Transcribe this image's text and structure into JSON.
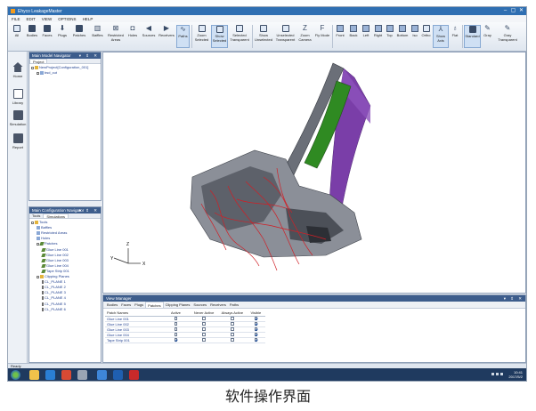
{
  "window": {
    "title": "Ehyco LeakageMaster",
    "controls": [
      "–",
      "▢",
      "✕"
    ]
  },
  "menu": [
    "FILE",
    "EDIT",
    "VIEW",
    "OPTIONS",
    "HELP"
  ],
  "ribbon": {
    "buttons": [
      {
        "label": "All"
      },
      {
        "label": "Bodies"
      },
      {
        "label": "Faces"
      },
      {
        "label": "Plugs"
      },
      {
        "label": "Patches"
      },
      {
        "label": "Baffles"
      },
      {
        "label": "Restricted\nAreas"
      },
      {
        "label": "Holes"
      },
      {
        "label": "Sources"
      },
      {
        "label": "Receivers"
      },
      {
        "label": "Paths"
      },
      {
        "label": "Zoom\nSelected"
      },
      {
        "label": "Show\nSelected"
      },
      {
        "label": "Selected\nTransparent"
      },
      {
        "label": "Show\nUnselected"
      },
      {
        "label": "Unselected\nTransparent"
      },
      {
        "label": "Zoom\nCamera"
      },
      {
        "label": "Fly Mode"
      },
      {
        "label": "Front"
      },
      {
        "label": "Back"
      },
      {
        "label": "Left"
      },
      {
        "label": "Right"
      },
      {
        "label": "Top"
      },
      {
        "label": "Bottom"
      },
      {
        "label": "Iso"
      },
      {
        "label": "Ortho"
      },
      {
        "label": "Show Axis"
      },
      {
        "label": "Flat"
      },
      {
        "label": "Standard"
      },
      {
        "label": "Gray"
      },
      {
        "label": "Gray\nTransparent"
      }
    ]
  },
  "leftbar": [
    "Home",
    "Library",
    "Simulation",
    "Report"
  ],
  "model_navigator": {
    "title": "Main Model Navigator",
    "tab": "Project",
    "tree": [
      "NewProject[Configuration_001]",
      "bsd_cut"
    ]
  },
  "config_navigator": {
    "title": "Main Configuration Navigator",
    "tabs": [
      "Tools",
      "Simulations"
    ],
    "tree": [
      {
        "label": "Tools",
        "depth": 0,
        "icon": "folder"
      },
      {
        "label": "Baffles",
        "depth": 1,
        "icon": "item"
      },
      {
        "label": "Restricted Areas",
        "depth": 1,
        "icon": "item"
      },
      {
        "label": "Holes",
        "depth": 1,
        "icon": "item"
      },
      {
        "label": "Patches",
        "depth": 1,
        "icon": "pencil"
      },
      {
        "label": "Glue Line 001",
        "depth": 2,
        "icon": "pencil"
      },
      {
        "label": "Glue Line 002",
        "depth": 2,
        "icon": "pencil"
      },
      {
        "label": "Glue Line 003",
        "depth": 2,
        "icon": "pencil"
      },
      {
        "label": "Glue Line 004",
        "depth": 2,
        "icon": "pencil"
      },
      {
        "label": "Tape Strip 001",
        "depth": 2,
        "icon": "pencil"
      },
      {
        "label": "Clipping Planes",
        "depth": 1,
        "icon": "folder"
      },
      {
        "label": "CL_PLANE 1",
        "depth": 2,
        "icon": "plane"
      },
      {
        "label": "CL_PLANE 2",
        "depth": 2,
        "icon": "plane"
      },
      {
        "label": "CL_PLANE 3",
        "depth": 2,
        "icon": "plane"
      },
      {
        "label": "CL_PLANE 4",
        "depth": 2,
        "icon": "plane"
      },
      {
        "label": "CL_PLANE 5",
        "depth": 2,
        "icon": "plane"
      },
      {
        "label": "CL_PLANE 6",
        "depth": 2,
        "icon": "plane"
      }
    ]
  },
  "viewport": {
    "axes": [
      "Z",
      "Y",
      "X"
    ]
  },
  "view_manager": {
    "title": "View Manager",
    "tabs": [
      "Bodies",
      "Faces",
      "Plugs",
      "Patches",
      "Clipping Planes",
      "Sources",
      "Receivers",
      "Paths"
    ],
    "active_tab": "Patches",
    "columns": [
      "Patch Names",
      "Active",
      "Never Active",
      "Always Active",
      "Visible"
    ],
    "rows": [
      {
        "name": "Glue Line 001",
        "active": false,
        "never": false,
        "always": false,
        "visible": true
      },
      {
        "name": "Glue Line 002",
        "active": false,
        "never": false,
        "always": false,
        "visible": true
      },
      {
        "name": "Glue Line 003",
        "active": false,
        "never": false,
        "always": false,
        "visible": true
      },
      {
        "name": "Glue Line 004",
        "active": false,
        "never": false,
        "always": false,
        "visible": true
      },
      {
        "name": "Tape Strip 001",
        "active": true,
        "never": false,
        "always": false,
        "visible": true
      }
    ]
  },
  "status": "Ready",
  "taskbar": {
    "time": "10:41",
    "date": "2017/5/2"
  },
  "caption": "软件操作界面"
}
